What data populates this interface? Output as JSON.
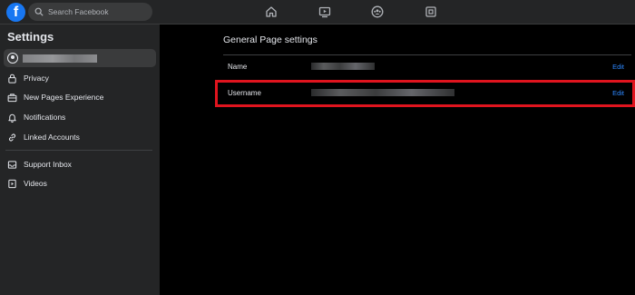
{
  "topbar": {
    "logo": "f",
    "search_placeholder": "Search Facebook",
    "nav_icons": [
      "home-icon",
      "watch-icon",
      "groups-icon",
      "gaming-icon"
    ]
  },
  "sidebar": {
    "title": "Settings",
    "items": [
      {
        "label": "Privacy",
        "icon": "lock-icon"
      },
      {
        "label": "New Pages Experience",
        "icon": "briefcase-icon"
      },
      {
        "label": "Notifications",
        "icon": "bell-icon"
      },
      {
        "label": "Linked Accounts",
        "icon": "link-icon"
      },
      {
        "label": "Support Inbox",
        "icon": "inbox-icon"
      },
      {
        "label": "Videos",
        "icon": "video-icon"
      }
    ]
  },
  "main": {
    "title": "General Page settings",
    "rows": [
      {
        "label": "Name",
        "edit": "Edit"
      },
      {
        "label": "Username",
        "edit": "Edit"
      }
    ],
    "highlight_color": "#e0141e"
  },
  "colors": {
    "accent": "#1877f2",
    "link": "#2d88ff",
    "sidebar_bg": "#242526",
    "main_bg": "#000000"
  }
}
